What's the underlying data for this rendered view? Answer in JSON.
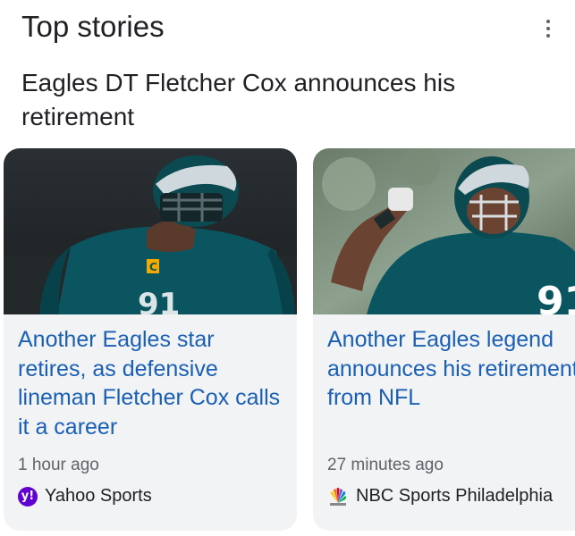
{
  "header": {
    "title": "Top stories",
    "more_icon": "more-vert-icon"
  },
  "headline": "Eagles DT Fletcher Cox announces his retirement",
  "cards": [
    {
      "title": "Another Eagles star retires, as defensive lineman Fletcher Cox calls it a career",
      "time": "1 hour ago",
      "source": "Yahoo Sports",
      "source_icon": "yahoo-logo-icon",
      "logo_text": "y!",
      "image": "eagles-player-photo"
    },
    {
      "title": "Another Eagles legend announces his retirement from NFL",
      "time": "27 minutes ago",
      "source": "NBC Sports Philadelphia",
      "source_icon": "nbc-peacock-icon",
      "jersey_number": "91",
      "image": "eagles-player-flexing-photo"
    }
  ],
  "colors": {
    "link": "#1a5fb4",
    "card_bg": "#f1f3f4",
    "eagles_green": "#004c54"
  }
}
